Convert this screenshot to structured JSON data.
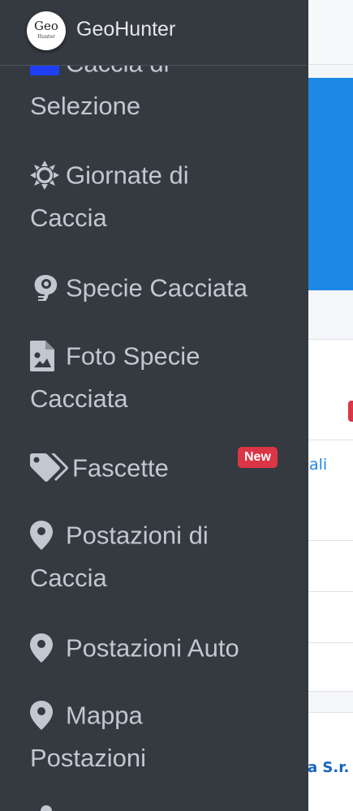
{
  "app": {
    "name": "GeoHunter",
    "logo_top": "Geo",
    "logo_bottom": "Hunter"
  },
  "sidebar": {
    "items": [
      {
        "label_line1": "Caccia di",
        "label_line2": "Selezione",
        "icon": "calendar-icon"
      },
      {
        "label_line1": "Giornate di",
        "label_line2": "Caccia",
        "icon": "sun-icon"
      },
      {
        "label_line1": "Specie Cacciata",
        "icon": "bird-icon"
      },
      {
        "label_line1": "Foto Specie",
        "label_line2": "Cacciata",
        "icon": "file-image-icon"
      },
      {
        "label_line1": "Fascette",
        "icon": "tags-icon",
        "badge": "New"
      },
      {
        "label_line1": "Postazioni di",
        "label_line2": "Caccia",
        "icon": "map-marker-icon"
      },
      {
        "label_line1": "Postazioni Auto",
        "icon": "map-marker-icon"
      },
      {
        "label_line1": "Mappa",
        "label_line2": "Postazioni",
        "icon": "map-marker-icon"
      }
    ]
  },
  "background_page": {
    "link_fragment": "ali",
    "footer_fragment": "a S.r."
  },
  "colors": {
    "sidebar_bg": "#343a40",
    "sidebar_text": "#c2c7d0",
    "badge_danger": "#dc3545",
    "accent_blue": "#1e88e5"
  }
}
